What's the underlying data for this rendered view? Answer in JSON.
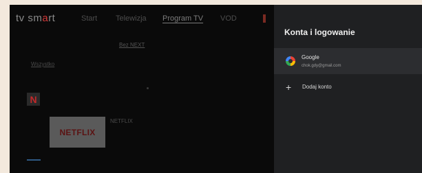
{
  "app": {
    "logo": {
      "left": "tv sm",
      "accent": "a",
      "right": "rt"
    },
    "nav": [
      "Start",
      "Telewizja",
      "Program TV",
      "VOD"
    ],
    "subtab": "Bez NEXT",
    "filter": "Wszystko",
    "netflix_badge": "N",
    "netflix_tile": "NETFLIX",
    "tile_caption": "NETFLIX"
  },
  "panel": {
    "title": "Konta i logowanie",
    "account": {
      "provider": "Google",
      "email": "chok.gdy@gmail.com"
    },
    "add_account": "Dodaj konto"
  },
  "colors": {
    "background": "#f3e9dd",
    "panel": "#1f2022",
    "selected_row": "#2c2d30",
    "accent": "#d43a3a"
  }
}
